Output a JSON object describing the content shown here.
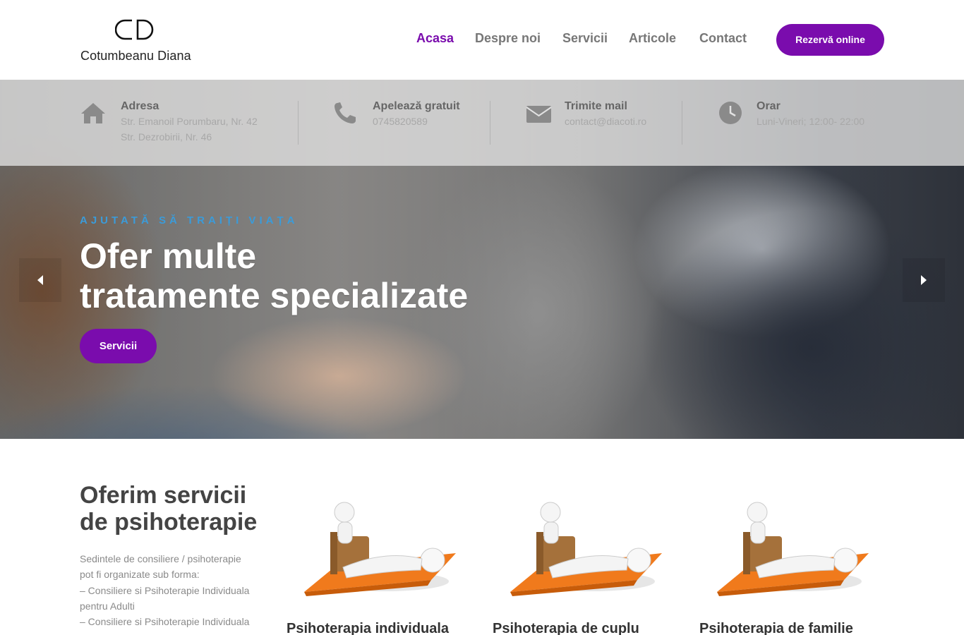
{
  "header": {
    "logo_text": "Cotumbeanu Diana",
    "nav": [
      {
        "label": "Acasa",
        "active": true
      },
      {
        "label": "Despre noi",
        "active": false
      },
      {
        "label": "Servicii",
        "active": false
      },
      {
        "label": "Articole",
        "active": false
      },
      {
        "label": "Contact",
        "active": false
      }
    ],
    "cta_label": "Rezervă online"
  },
  "info": {
    "address": {
      "title": "Adresa",
      "lines": [
        "Str. Emanoil Porumbaru, Nr. 42",
        "Str. Dezrobirii, Nr. 46"
      ],
      "icon": "home-icon"
    },
    "phone": {
      "title": "Apelează gratuit",
      "value": "0745820589",
      "icon": "phone-icon"
    },
    "mail": {
      "title": "Trimite mail",
      "value": "contact@diacoti.ro",
      "icon": "envelope-icon"
    },
    "hours": {
      "title": "Orar",
      "value": "Luni-Vineri; 12:00- 22:00",
      "icon": "clock-icon"
    }
  },
  "hero": {
    "subtitle": "AJUTATĂ SĂ TRAIȚI VIAȚA",
    "title_line1": "Ofer multe",
    "title_line2": "tratamente specializate",
    "button_label": "Servicii"
  },
  "services": {
    "title_line1": "Oferim servicii",
    "title_line2": "de psihoterapie",
    "description_lines": [
      "Sedintele de consiliere / psihoterapie",
      "pot fi organizate sub forma:",
      "– Consiliere si Psihoterapie Individuala",
      "pentru Adulti",
      "– Consiliere si Psihoterapie Individuala"
    ],
    "cards": [
      {
        "title": "Psihoterapia individuala"
      },
      {
        "title": "Psihoterapia de cuplu"
      },
      {
        "title": "Psihoterapia de familie"
      }
    ]
  },
  "colors": {
    "accent": "#7a0cad",
    "subtitle": "#3b9bd9"
  }
}
